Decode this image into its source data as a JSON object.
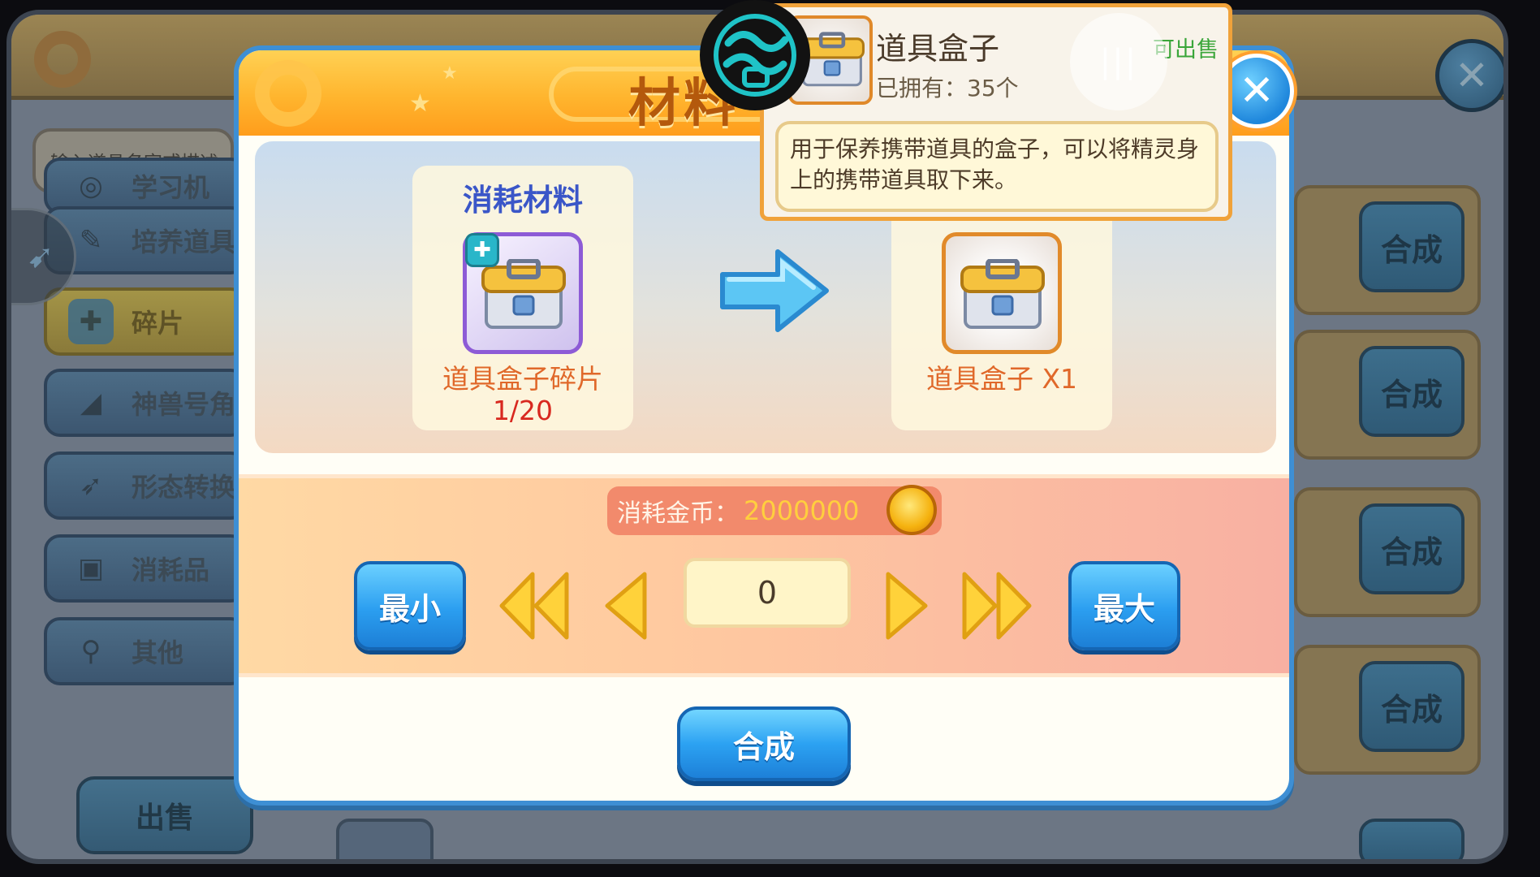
{
  "background": {
    "search_placeholder": "输入道具名字或描述",
    "menu": [
      {
        "label": "学习机",
        "icon": "disc-icon"
      },
      {
        "label": "培养道具",
        "icon": "tools-icon"
      },
      {
        "label": "碎片",
        "icon": "puzzle-icon",
        "active": true
      },
      {
        "label": "神兽号角",
        "icon": "horn-icon"
      },
      {
        "label": "形态转换",
        "icon": "dart-icon"
      },
      {
        "label": "消耗品",
        "icon": "box-icon"
      },
      {
        "label": "其他",
        "icon": "magnifier-icon"
      }
    ],
    "sell_label": "出售",
    "compose_label": "合成"
  },
  "dialog": {
    "title": "材料",
    "input_slot": {
      "title": "消耗材料",
      "name": "道具盒子碎片",
      "count": "1/20"
    },
    "output_slot": {
      "name": "道具盒子 X1"
    },
    "cost": {
      "label": "消耗金币：",
      "value": "2000000"
    },
    "min_label": "最小",
    "max_label": "最大",
    "quantity": "0",
    "compose_label": "合成"
  },
  "tooltip": {
    "name": "道具盒子",
    "owned": "已拥有：35个",
    "sellable": "可出售",
    "description": "用于保养携带道具的盒子，可以将精灵身上的携带道具取下来。"
  },
  "colors": {
    "accent_blue": "#2b9ef0",
    "header_orange": "#ffb52e",
    "title_brown": "#b4590c",
    "count_red": "#d8281f",
    "sellable_green": "#3ba63a"
  }
}
